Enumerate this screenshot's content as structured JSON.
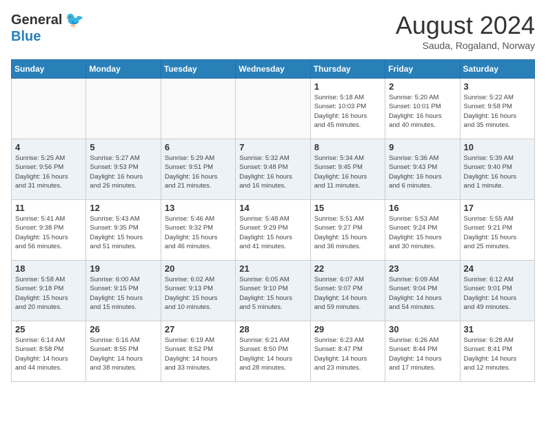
{
  "logo": {
    "general": "General",
    "blue": "Blue"
  },
  "title": "August 2024",
  "subtitle": "Sauda, Rogaland, Norway",
  "weekdays": [
    "Sunday",
    "Monday",
    "Tuesday",
    "Wednesday",
    "Thursday",
    "Friday",
    "Saturday"
  ],
  "weeks": [
    [
      {
        "day": "",
        "info": ""
      },
      {
        "day": "",
        "info": ""
      },
      {
        "day": "",
        "info": ""
      },
      {
        "day": "",
        "info": ""
      },
      {
        "day": "1",
        "info": "Sunrise: 5:18 AM\nSunset: 10:03 PM\nDaylight: 16 hours\nand 45 minutes."
      },
      {
        "day": "2",
        "info": "Sunrise: 5:20 AM\nSunset: 10:01 PM\nDaylight: 16 hours\nand 40 minutes."
      },
      {
        "day": "3",
        "info": "Sunrise: 5:22 AM\nSunset: 9:58 PM\nDaylight: 16 hours\nand 35 minutes."
      }
    ],
    [
      {
        "day": "4",
        "info": "Sunrise: 5:25 AM\nSunset: 9:56 PM\nDaylight: 16 hours\nand 31 minutes."
      },
      {
        "day": "5",
        "info": "Sunrise: 5:27 AM\nSunset: 9:53 PM\nDaylight: 16 hours\nand 26 minutes."
      },
      {
        "day": "6",
        "info": "Sunrise: 5:29 AM\nSunset: 9:51 PM\nDaylight: 16 hours\nand 21 minutes."
      },
      {
        "day": "7",
        "info": "Sunrise: 5:32 AM\nSunset: 9:48 PM\nDaylight: 16 hours\nand 16 minutes."
      },
      {
        "day": "8",
        "info": "Sunrise: 5:34 AM\nSunset: 9:45 PM\nDaylight: 16 hours\nand 11 minutes."
      },
      {
        "day": "9",
        "info": "Sunrise: 5:36 AM\nSunset: 9:43 PM\nDaylight: 16 hours\nand 6 minutes."
      },
      {
        "day": "10",
        "info": "Sunrise: 5:39 AM\nSunset: 9:40 PM\nDaylight: 16 hours\nand 1 minute."
      }
    ],
    [
      {
        "day": "11",
        "info": "Sunrise: 5:41 AM\nSunset: 9:38 PM\nDaylight: 15 hours\nand 56 minutes."
      },
      {
        "day": "12",
        "info": "Sunrise: 5:43 AM\nSunset: 9:35 PM\nDaylight: 15 hours\nand 51 minutes."
      },
      {
        "day": "13",
        "info": "Sunrise: 5:46 AM\nSunset: 9:32 PM\nDaylight: 15 hours\nand 46 minutes."
      },
      {
        "day": "14",
        "info": "Sunrise: 5:48 AM\nSunset: 9:29 PM\nDaylight: 15 hours\nand 41 minutes."
      },
      {
        "day": "15",
        "info": "Sunrise: 5:51 AM\nSunset: 9:27 PM\nDaylight: 15 hours\nand 36 minutes."
      },
      {
        "day": "16",
        "info": "Sunrise: 5:53 AM\nSunset: 9:24 PM\nDaylight: 15 hours\nand 30 minutes."
      },
      {
        "day": "17",
        "info": "Sunrise: 5:55 AM\nSunset: 9:21 PM\nDaylight: 15 hours\nand 25 minutes."
      }
    ],
    [
      {
        "day": "18",
        "info": "Sunrise: 5:58 AM\nSunset: 9:18 PM\nDaylight: 15 hours\nand 20 minutes."
      },
      {
        "day": "19",
        "info": "Sunrise: 6:00 AM\nSunset: 9:15 PM\nDaylight: 15 hours\nand 15 minutes."
      },
      {
        "day": "20",
        "info": "Sunrise: 6:02 AM\nSunset: 9:13 PM\nDaylight: 15 hours\nand 10 minutes."
      },
      {
        "day": "21",
        "info": "Sunrise: 6:05 AM\nSunset: 9:10 PM\nDaylight: 15 hours\nand 5 minutes."
      },
      {
        "day": "22",
        "info": "Sunrise: 6:07 AM\nSunset: 9:07 PM\nDaylight: 14 hours\nand 59 minutes."
      },
      {
        "day": "23",
        "info": "Sunrise: 6:09 AM\nSunset: 9:04 PM\nDaylight: 14 hours\nand 54 minutes."
      },
      {
        "day": "24",
        "info": "Sunrise: 6:12 AM\nSunset: 9:01 PM\nDaylight: 14 hours\nand 49 minutes."
      }
    ],
    [
      {
        "day": "25",
        "info": "Sunrise: 6:14 AM\nSunset: 8:58 PM\nDaylight: 14 hours\nand 44 minutes."
      },
      {
        "day": "26",
        "info": "Sunrise: 6:16 AM\nSunset: 8:55 PM\nDaylight: 14 hours\nand 38 minutes."
      },
      {
        "day": "27",
        "info": "Sunrise: 6:19 AM\nSunset: 8:52 PM\nDaylight: 14 hours\nand 33 minutes."
      },
      {
        "day": "28",
        "info": "Sunrise: 6:21 AM\nSunset: 8:50 PM\nDaylight: 14 hours\nand 28 minutes."
      },
      {
        "day": "29",
        "info": "Sunrise: 6:23 AM\nSunset: 8:47 PM\nDaylight: 14 hours\nand 23 minutes."
      },
      {
        "day": "30",
        "info": "Sunrise: 6:26 AM\nSunset: 8:44 PM\nDaylight: 14 hours\nand 17 minutes."
      },
      {
        "day": "31",
        "info": "Sunrise: 6:28 AM\nSunset: 8:41 PM\nDaylight: 14 hours\nand 12 minutes."
      }
    ]
  ]
}
